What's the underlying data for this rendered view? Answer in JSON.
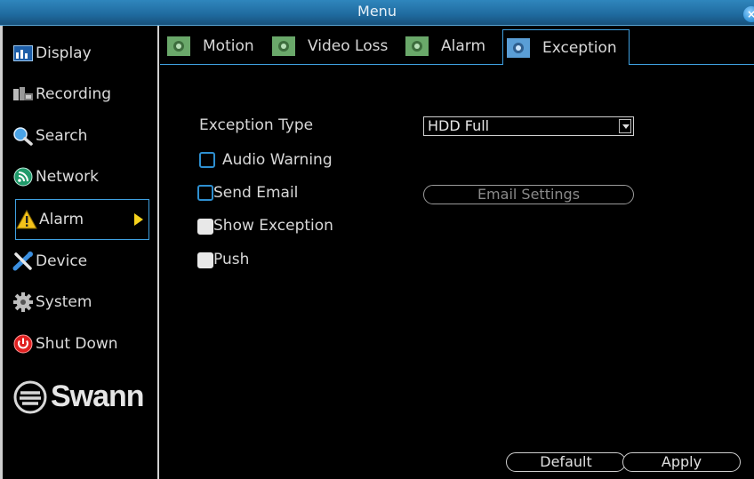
{
  "window": {
    "title": "Menu",
    "close_label": "×"
  },
  "sidebar": {
    "items": [
      {
        "label": "Display",
        "icon": "display-icon"
      },
      {
        "label": "Recording",
        "icon": "recording-icon"
      },
      {
        "label": "Search",
        "icon": "search-icon"
      },
      {
        "label": "Network",
        "icon": "network-icon"
      },
      {
        "label": "Alarm",
        "icon": "alarm-warning-icon",
        "active": true
      },
      {
        "label": "Device",
        "icon": "device-tools-icon"
      },
      {
        "label": "System",
        "icon": "system-gear-icon"
      },
      {
        "label": "Shut Down",
        "icon": "power-icon"
      }
    ],
    "logo": "Swann"
  },
  "tabs": [
    {
      "label": "Motion"
    },
    {
      "label": "Video Loss"
    },
    {
      "label": "Alarm"
    },
    {
      "label": "Exception",
      "active": true
    }
  ],
  "form": {
    "exception_type_label": "Exception Type",
    "exception_type_value": "HDD Full",
    "audio_warning_label": "Audio Warning",
    "audio_warning_checked": false,
    "send_email_label": "Send Email",
    "send_email_checked": false,
    "email_settings_label": "Email Settings",
    "show_exception_label": "Show Exception",
    "show_exception_checked": true,
    "push_label": "Push",
    "push_checked": true
  },
  "footer": {
    "default_label": "Default",
    "apply_label": "Apply"
  },
  "colors": {
    "accent": "#3fa0e0",
    "titlebar": "#1f6a9e",
    "alarm_arrow": "#f6d21c"
  }
}
